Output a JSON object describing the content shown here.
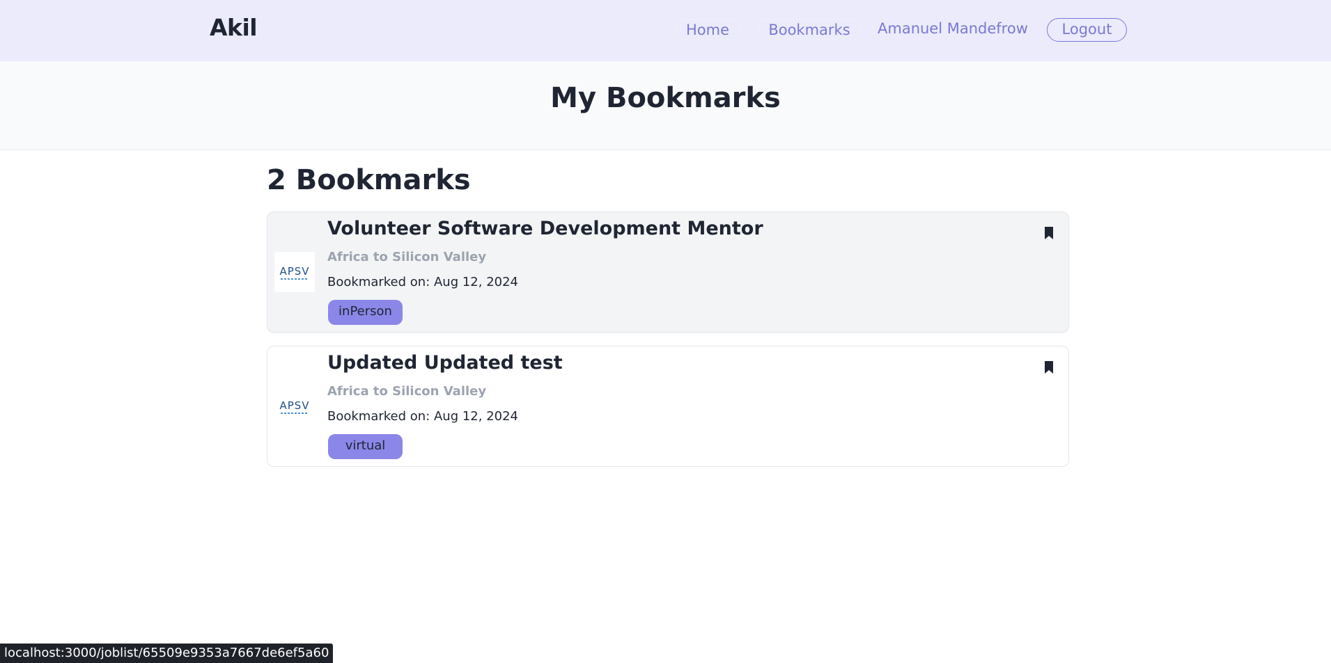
{
  "header": {
    "brand": "Akil",
    "nav": {
      "home": "Home",
      "bookmarks": "Bookmarks",
      "user_name": "Amanuel Mandefrow",
      "logout": "Logout"
    }
  },
  "page": {
    "title": "My Bookmarks",
    "count_heading": "2 Bookmarks"
  },
  "bookmarks": [
    {
      "title": "Volunteer Software Development Mentor",
      "organization": "Africa to Silicon Valley",
      "bookmarked_on": "Bookmarked on: Aug 12, 2024",
      "tag": "inPerson",
      "logo_text": "APSV",
      "icon": "bookmark-filled-icon"
    },
    {
      "title": "Updated Updated test",
      "organization": "Africa to Silicon Valley",
      "bookmarked_on": "Bookmarked on: Aug 12, 2024",
      "tag": "virtual",
      "logo_text": "APSV",
      "icon": "bookmark-filled-icon"
    }
  ],
  "statusbar": {
    "url": "localhost:3000/joblist/65509e9353a7667de6ef5a60"
  },
  "colors": {
    "nav_bg": "#ebebfb",
    "accent": "#7b79d3",
    "tag_bg": "#8b87e8",
    "heading": "#1f2533",
    "muted": "#9ca3af"
  }
}
